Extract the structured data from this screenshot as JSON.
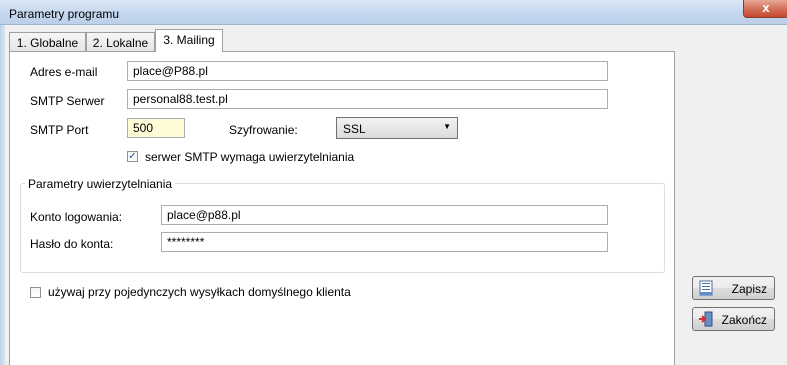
{
  "window": {
    "title": "Parametry programu",
    "close_glyph": "x"
  },
  "tabs": [
    {
      "label": "1. Globalne"
    },
    {
      "label": "2. Lokalne"
    },
    {
      "label": "3. Mailing",
      "active": true
    }
  ],
  "mailing": {
    "email_label": "Adres e-mail",
    "email_value": "place@P88.pl",
    "smtp_server_label": "SMTP Serwer",
    "smtp_server_value": "personal88.test.pl",
    "smtp_port_label": "SMTP Port",
    "smtp_port_value": "500",
    "encryption_label": "Szyfrowanie:",
    "encryption_value": "SSL",
    "auth_required_label": "serwer SMTP wymaga uwierzytelniania",
    "auth_required_checked": true
  },
  "auth_group": {
    "legend": "Parametry uwierzytelniania",
    "login_label": "Konto logowania:",
    "login_value": "place@p88.pl",
    "password_label": "Hasło do konta:",
    "password_value": "********"
  },
  "default_client": {
    "label": "używaj przy pojedynczych wysyłkach domyślnego klienta",
    "checked": false
  },
  "buttons": {
    "save_label": "Zapisz",
    "save_icon": "save-document-icon",
    "close_label": "Zakończ",
    "close_icon": "exit-door-icon"
  }
}
